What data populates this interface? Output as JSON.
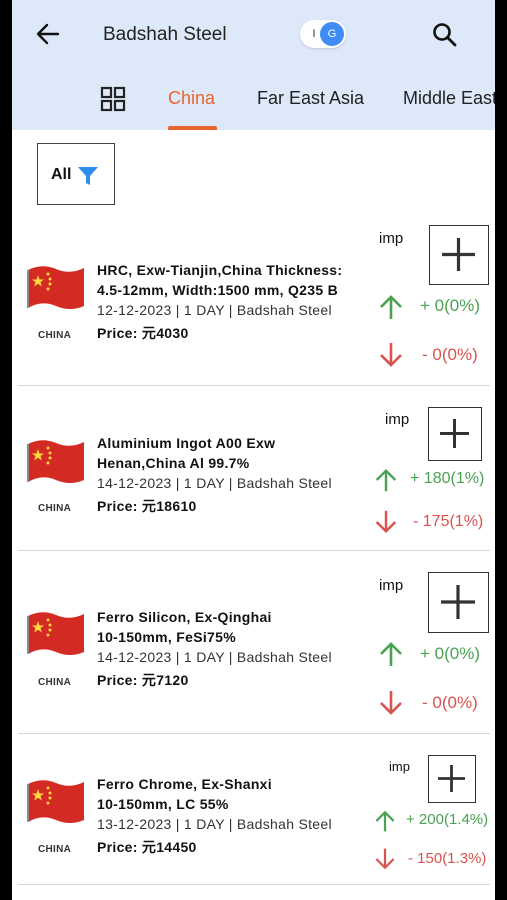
{
  "header": {
    "title": "Badshah Steel",
    "toggle_left": "I",
    "toggle_right": "G"
  },
  "tabs": [
    {
      "label": "China",
      "active": true
    },
    {
      "label": "Far East Asia",
      "active": false
    },
    {
      "label": "Middle East",
      "active": false
    }
  ],
  "filter": {
    "label": "All"
  },
  "colors": {
    "accent": "#e8652f",
    "header_bg": "#dde9f9",
    "up": "#4aa152",
    "down": "#d9534f",
    "filter_icon": "#2e8de8"
  },
  "items": [
    {
      "country": "CHINA",
      "desc_line1": "HRC, Exw-Tianjin,China Thickness:",
      "desc_line2": "4.5-12mm, Width:1500 mm, Q235 B",
      "meta": "12-12-2023 | 1 DAY | Badshah Steel",
      "price": "Price: 元4030",
      "imp": "imp",
      "up": "+ 0(0%)",
      "down": "- 0(0%)"
    },
    {
      "country": "CHINA",
      "desc_line1": "Aluminium Ingot A00 Exw",
      "desc_line2": "Henan,China Al 99.7%",
      "meta": "14-12-2023 | 1 DAY | Badshah Steel",
      "price": "Price: 元18610",
      "imp": "imp",
      "up": "+ 180(1%)",
      "down": "- 175(1%)"
    },
    {
      "country": "CHINA",
      "desc_line1": "Ferro Silicon, Ex-Qinghai",
      "desc_line2": "10-150mm, FeSi75%",
      "meta": "14-12-2023 | 1 DAY | Badshah Steel",
      "price": "Price: 元7120",
      "imp": "imp",
      "up": "+ 0(0%)",
      "down": "- 0(0%)"
    },
    {
      "country": "CHINA",
      "desc_line1": "Ferro Chrome, Ex-Shanxi",
      "desc_line2": "10-150mm, LC 55%",
      "meta": "13-12-2023 | 1 DAY | Badshah Steel",
      "price": "Price: 元14450",
      "imp": "imp",
      "up": "+ 200(1.4%)",
      "down": "- 150(1.3%)"
    }
  ]
}
